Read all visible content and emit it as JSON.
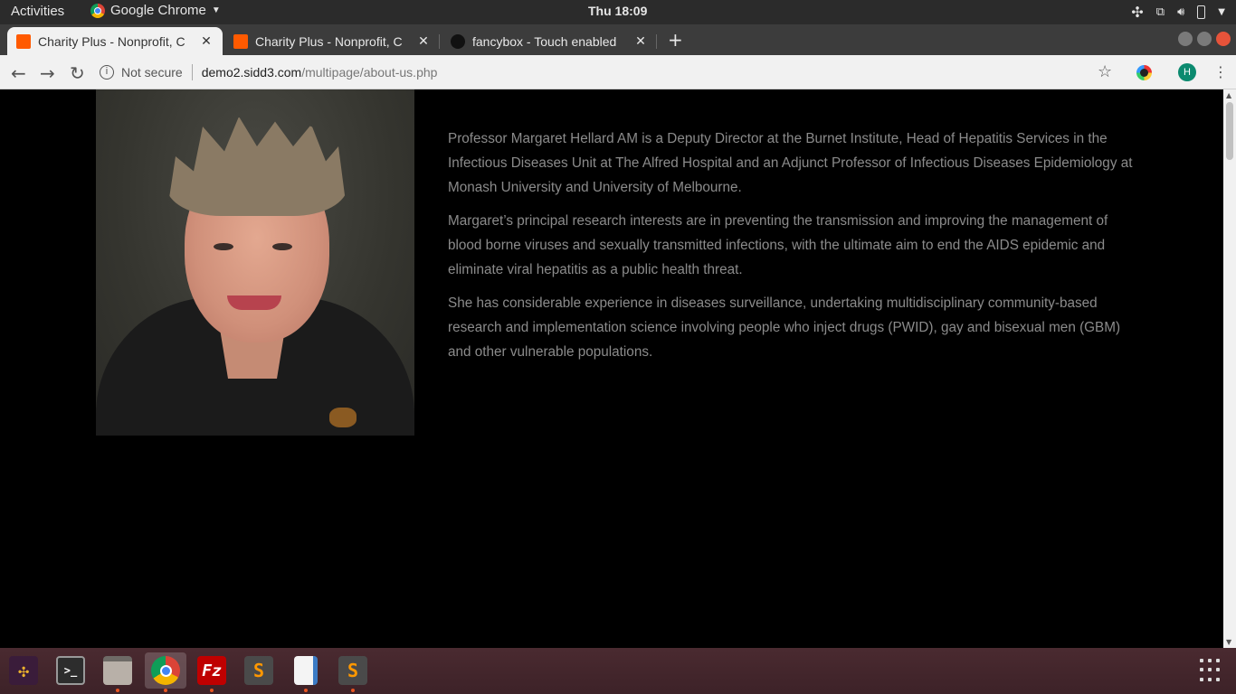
{
  "system": {
    "activities": "Activities",
    "app_name": "Google Chrome",
    "clock": "Thu 18:09"
  },
  "tabs": [
    {
      "title": "Charity Plus - Nonprofit, C",
      "favicon_color": "#ff5a00",
      "active": true
    },
    {
      "title": "Charity Plus - Nonprofit, C",
      "favicon_color": "#ff5a00",
      "active": false
    },
    {
      "title": "fancybox - Touch enabled",
      "favicon_color": "#222222",
      "active": false
    }
  ],
  "toolbar": {
    "security_label": "Not secure",
    "url_host": "demo2.sidd3.com",
    "url_path": "/multipage/about-us.php",
    "profile_initial": "H"
  },
  "bio": {
    "paragraphs": [
      "Professor Margaret Hellard AM is a Deputy Director at the Burnet Institute, Head of Hepatitis Services in the Infectious Diseases Unit at The Alfred Hospital and an Adjunct Professor of Infectious Diseases Epidemiology at Monash University and University of Melbourne.",
      "Margaret’s principal research interests are in preventing the transmission and improving the management of blood borne viruses and sexually transmitted infections, with the ultimate aim to end the AIDS epidemic and eliminate viral hepatitis as a public health threat.",
      "She has considerable experience in diseases surveillance, undertaking multidisciplinary community-based research and implementation science involving people who inject drugs (PWID), gay and bisexual men (GBM) and other vulnerable populations."
    ]
  },
  "dock": {
    "apps": [
      "slack",
      "terminal",
      "files",
      "chrome",
      "filezilla",
      "sublime-text",
      "document-viewer",
      "sublime-text"
    ],
    "accent": "#e95420"
  }
}
